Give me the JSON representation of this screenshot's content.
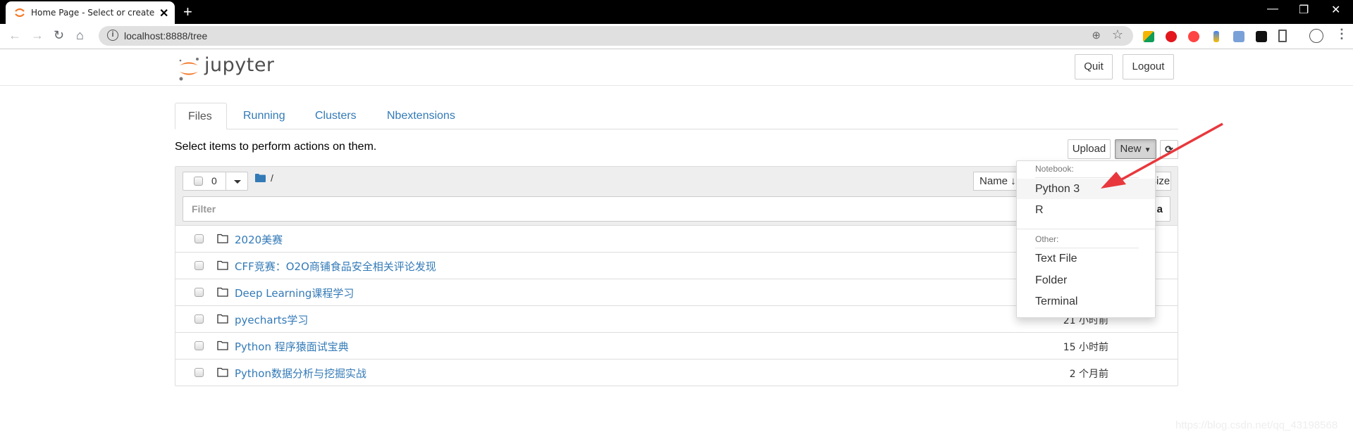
{
  "browser": {
    "tab_title": "Home Page - Select or create a notebook",
    "url": "localhost:8888/tree",
    "new_tab_symbol": "+",
    "close_symbol": "✕",
    "icons": [
      "back-icon",
      "forward-icon",
      "reload-icon",
      "home-icon",
      "info-icon",
      "zoom-icon",
      "bookmark-star-icon",
      "extension-icons",
      "reading-list-icon",
      "profile-avatar-icon",
      "menu-icon"
    ]
  },
  "header": {
    "logo_text": "jupyter",
    "quit_label": "Quit",
    "logout_label": "Logout"
  },
  "tabs": [
    {
      "label": "Files",
      "active": true
    },
    {
      "label": "Running",
      "active": false
    },
    {
      "label": "Clusters",
      "active": false
    },
    {
      "label": "Nbextensions",
      "active": false
    }
  ],
  "toolbar": {
    "hint": "Select items to perform actions on them.",
    "upload_label": "Upload",
    "new_label": "New",
    "refresh_symbol": "⟳"
  },
  "list": {
    "selected_count": "0",
    "breadcrumb_root": "/",
    "name_sort_label": "Name ↓",
    "size_sort_label": "Size",
    "filter_placeholder": "Filter",
    "filter_trail": "a",
    "items": [
      {
        "name": "2020美赛",
        "modified": ""
      },
      {
        "name": "CFF竞赛：O2O商铺食品安全相关评论发现",
        "modified": ""
      },
      {
        "name": "Deep Learning课程学习",
        "modified": ""
      },
      {
        "name": "pyecharts学习",
        "modified": "21 小时前"
      },
      {
        "name": "Python 程序猿面试宝典",
        "modified": "15 小时前"
      },
      {
        "name": "Python数据分析与挖掘实战",
        "modified": "2 个月前"
      }
    ]
  },
  "new_menu": {
    "notebook_header": "Notebook:",
    "notebook_items": [
      "Python 3",
      "R"
    ],
    "other_header": "Other:",
    "other_items": [
      "Text File",
      "Folder",
      "Terminal"
    ],
    "highlighted": "Python 3"
  },
  "colors": {
    "link": "#337ab7",
    "jupyter_orange": "#f37726",
    "annotation_arrow": "#e8383d"
  },
  "watermark": "https://blog.csdn.net/qq_43198568"
}
